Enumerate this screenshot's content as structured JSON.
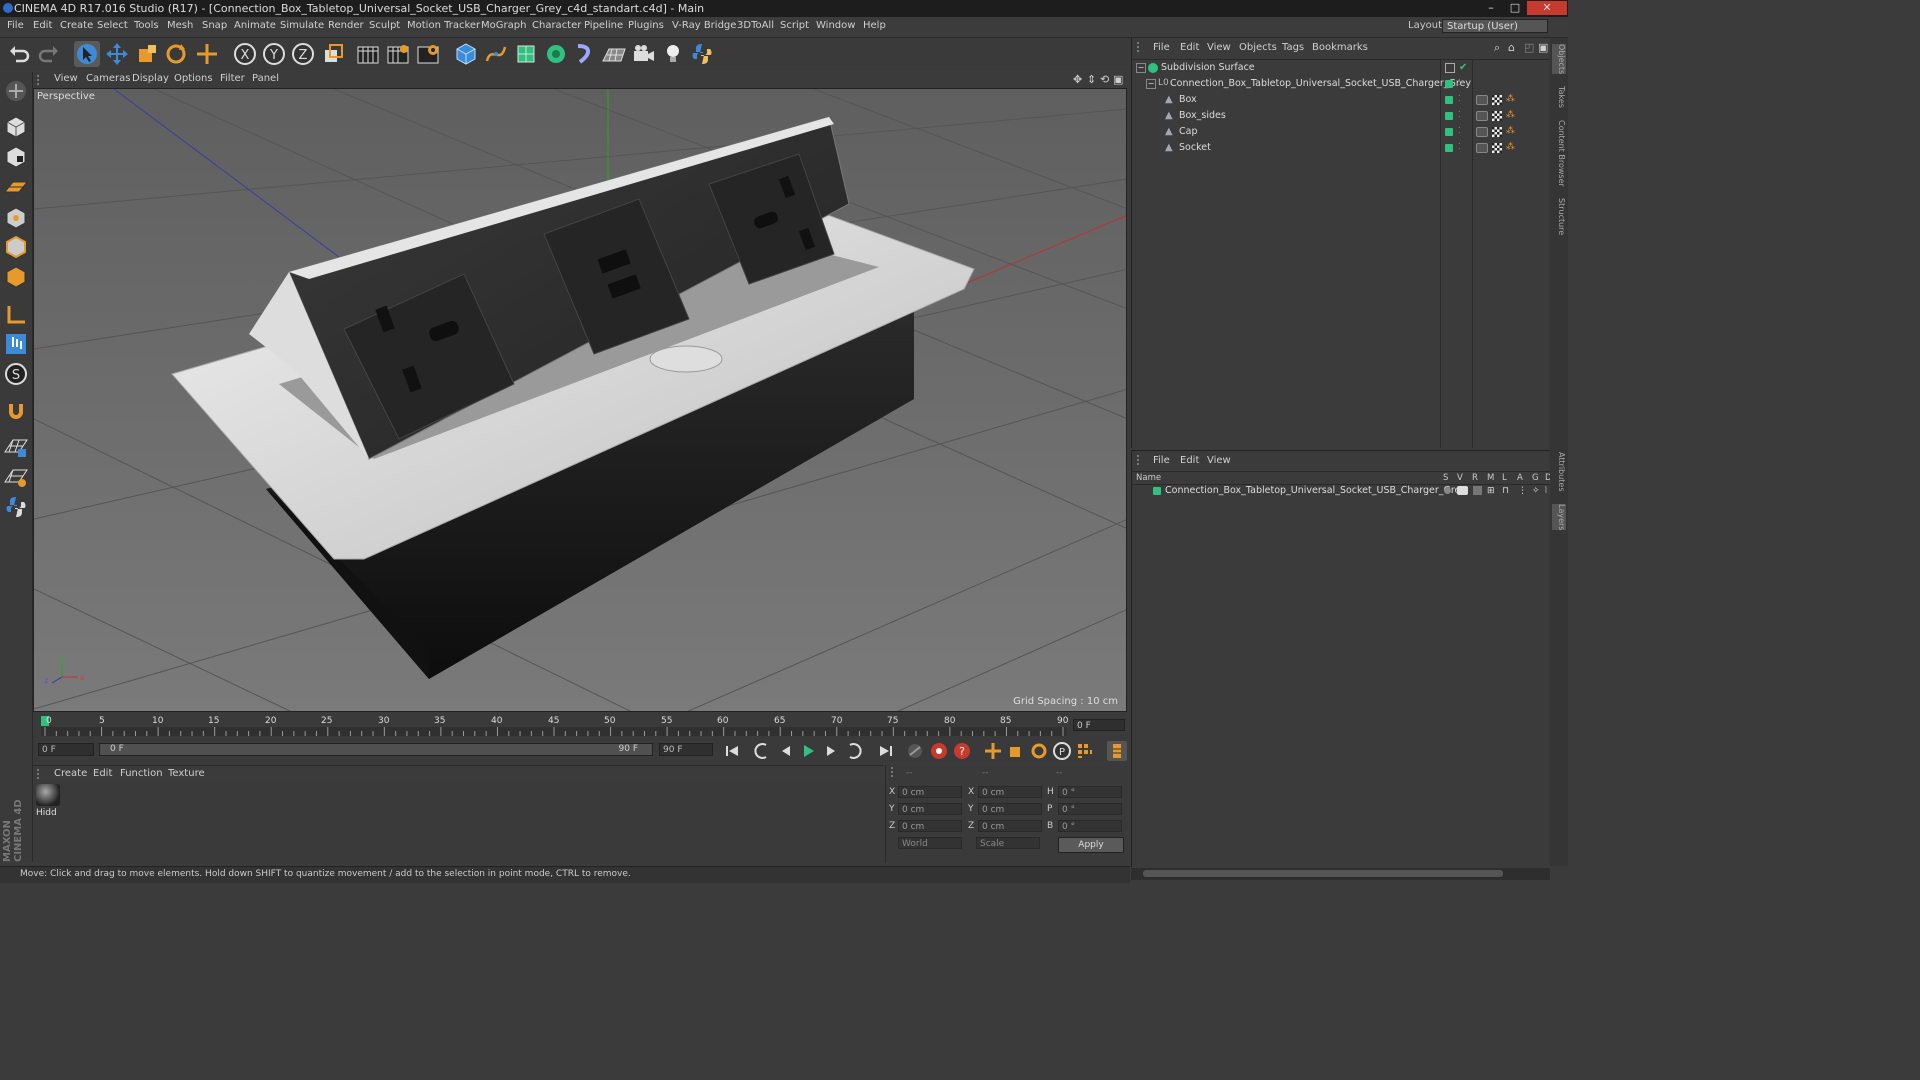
{
  "window": {
    "title": "CINEMA 4D R17.016 Studio (R17) - [Connection_Box_Tabletop_Universal_Socket_USB_Charger_Grey_c4d_standart.c4d] - Main",
    "min": "–",
    "max": "□",
    "close": "✕"
  },
  "menu": [
    "File",
    "Edit",
    "Create",
    "Select",
    "Tools",
    "Mesh",
    "Snap",
    "Animate",
    "Simulate",
    "Render",
    "Sculpt",
    "Motion Tracker",
    "MoGraph",
    "Character",
    "Pipeline",
    "Plugins",
    "V-Ray Bridge",
    "3DToAll",
    "Script",
    "Window",
    "Help"
  ],
  "layout": {
    "label": "Layout:",
    "value": "Startup (User)"
  },
  "viewport": {
    "menu": [
      "View",
      "Cameras",
      "Display",
      "Options",
      "Filter",
      "Panel"
    ],
    "label": "Perspective",
    "grid_spacing": "Grid Spacing : 10 cm"
  },
  "timeline": {
    "ticks": [
      "0",
      "5",
      "10",
      "15",
      "20",
      "25",
      "30",
      "35",
      "40",
      "45",
      "50",
      "55",
      "60",
      "65",
      "70",
      "75",
      "80",
      "85",
      "90"
    ],
    "current_frame": "0 F",
    "start_field": "0 F",
    "range_start": "0 F",
    "range_end": "90 F",
    "end_field": "90 F"
  },
  "material_manager": {
    "menu": [
      "Create",
      "Edit",
      "Function",
      "Texture"
    ],
    "material_name": "Hidd"
  },
  "coords": {
    "rows": [
      {
        "a": "X",
        "av": "0 cm",
        "b": "X",
        "bv": "0 cm",
        "c": "H",
        "cv": "0 °"
      },
      {
        "a": "Y",
        "av": "0 cm",
        "b": "Y",
        "bv": "0 cm",
        "c": "P",
        "cv": "0 °"
      },
      {
        "a": "Z",
        "av": "0 cm",
        "b": "Z",
        "bv": "0 cm",
        "c": "B",
        "cv": "0 °"
      }
    ],
    "header": [
      "--",
      "--",
      "--"
    ],
    "world": "World",
    "scale": "Scale",
    "apply": "Apply"
  },
  "status": "Move: Click and drag to move elements. Hold down SHIFT to quantize movement / add to the selection in point mode, CTRL to remove.",
  "objects_panel": {
    "menu": [
      "File",
      "Edit",
      "View",
      "Objects",
      "Tags",
      "Bookmarks"
    ],
    "items": [
      {
        "name": "Subdivision Surface",
        "indent": 0
      },
      {
        "name": "Connection_Box_Tabletop_Universal_Socket_USB_Charger_Grey",
        "indent": 1
      },
      {
        "name": "Box",
        "indent": 2
      },
      {
        "name": "Box_sides",
        "indent": 2
      },
      {
        "name": "Cap",
        "indent": 2
      },
      {
        "name": "Socket",
        "indent": 2
      }
    ]
  },
  "layers_panel": {
    "menu": [
      "File",
      "Edit",
      "View"
    ],
    "columns": [
      "Name",
      "S",
      "V",
      "R",
      "M",
      "L",
      "A",
      "G",
      "D"
    ],
    "layer": "Connection_Box_Tabletop_Universal_Socket_USB_Charger_Grey"
  },
  "right_tabs": [
    "Objects",
    "Takes",
    "Content Browser",
    "Structure",
    "Attributes",
    "Layers"
  ],
  "brand": "MAXON CINEMA 4D",
  "colors": {
    "accent": "#2ec27e",
    "close": "#c73a2e",
    "viewport_bg": "#6a6a6a",
    "tool_blue": "#3c8ad8",
    "tool_orange": "#e59a2b"
  }
}
